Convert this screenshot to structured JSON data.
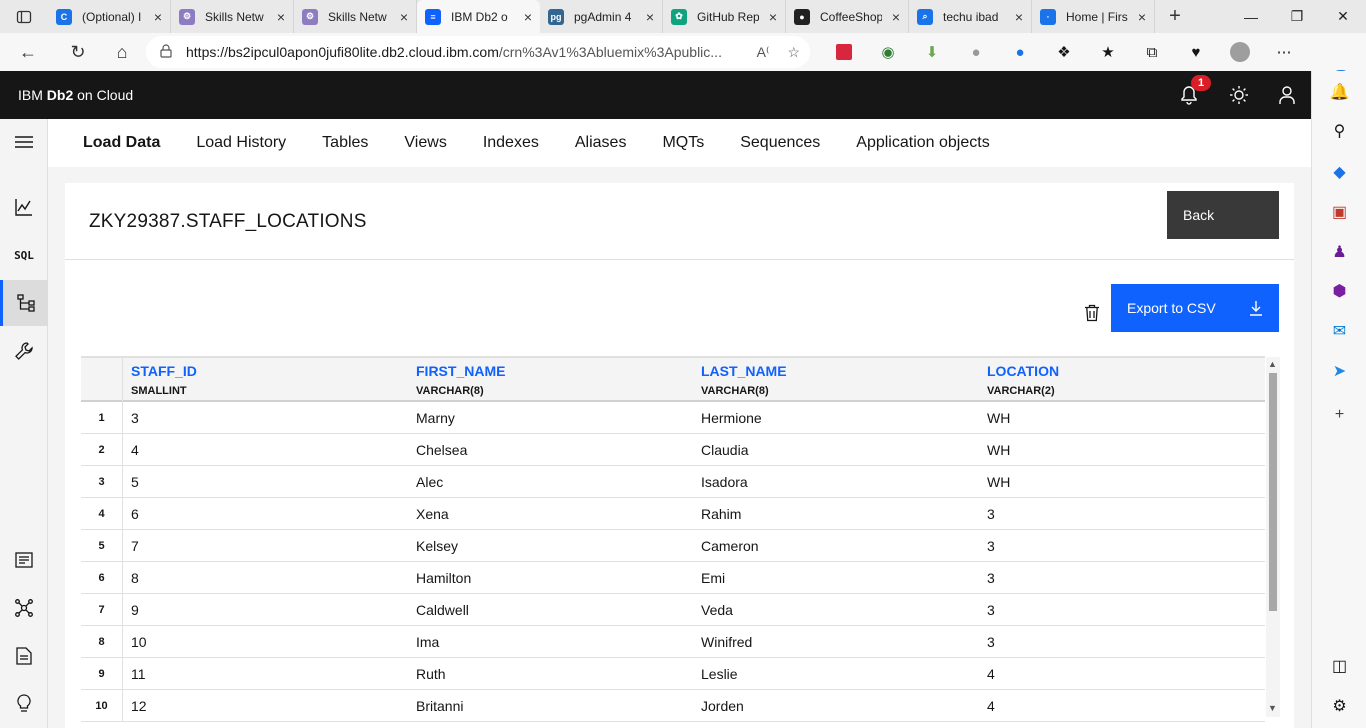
{
  "browser": {
    "tabs": [
      {
        "title": "(Optional) I",
        "icon": "C",
        "color": "#1a73e8"
      },
      {
        "title": "Skills Netw",
        "icon": "⚙",
        "color": "#8e7cc3"
      },
      {
        "title": "Skills Netw",
        "icon": "⚙",
        "color": "#8e7cc3"
      },
      {
        "title": "IBM Db2 o",
        "icon": "≡",
        "color": "#0f62fe",
        "active": true
      },
      {
        "title": "pgAdmin 4",
        "icon": "pg",
        "color": "#336791"
      },
      {
        "title": "GitHub Rep",
        "icon": "✿",
        "color": "#10a37f"
      },
      {
        "title": "CoffeeShop",
        "icon": "●",
        "color": "#222222"
      },
      {
        "title": "techu ibad",
        "icon": "⌕",
        "color": "#1a73e8"
      },
      {
        "title": "Home | Firs",
        "icon": "∙",
        "color": "#1a73e8"
      }
    ],
    "url_host": "https://bs2ipcul0apon0jufi80lite.db2.cloud.ibm.com",
    "url_path": "/crn%3Av1%3Abluemix%3Apublic..."
  },
  "app": {
    "brand_prefix": "IBM ",
    "brand_bold": "Db2",
    "brand_suffix": " on Cloud",
    "notification_count": "1"
  },
  "nav": {
    "tabs": [
      "Load Data",
      "Load History",
      "Tables",
      "Views",
      "Indexes",
      "Aliases",
      "MQTs",
      "Sequences",
      "Application objects"
    ]
  },
  "page": {
    "title": "ZKY29387.STAFF_LOCATIONS",
    "back_label": "Back",
    "export_label": "Export to CSV"
  },
  "table": {
    "columns": [
      {
        "name": "STAFF_ID",
        "type": "SMALLINT"
      },
      {
        "name": "FIRST_NAME",
        "type": "VARCHAR(8)"
      },
      {
        "name": "LAST_NAME",
        "type": "VARCHAR(8)"
      },
      {
        "name": "LOCATION",
        "type": "VARCHAR(2)"
      }
    ],
    "rows": [
      {
        "n": "1",
        "staff_id": "3",
        "first_name": "Marny",
        "last_name": "Hermione",
        "location": "WH"
      },
      {
        "n": "2",
        "staff_id": "4",
        "first_name": "Chelsea",
        "last_name": "Claudia",
        "location": "WH"
      },
      {
        "n": "3",
        "staff_id": "5",
        "first_name": "Alec",
        "last_name": "Isadora",
        "location": "WH"
      },
      {
        "n": "4",
        "staff_id": "6",
        "first_name": "Xena",
        "last_name": "Rahim",
        "location": "3"
      },
      {
        "n": "5",
        "staff_id": "7",
        "first_name": "Kelsey",
        "last_name": "Cameron",
        "location": "3"
      },
      {
        "n": "6",
        "staff_id": "8",
        "first_name": "Hamilton",
        "last_name": "Emi",
        "location": "3"
      },
      {
        "n": "7",
        "staff_id": "9",
        "first_name": "Caldwell",
        "last_name": "Veda",
        "location": "3"
      },
      {
        "n": "8",
        "staff_id": "10",
        "first_name": "Ima",
        "last_name": "Winifred",
        "location": "3"
      },
      {
        "n": "9",
        "staff_id": "11",
        "first_name": "Ruth",
        "last_name": "Leslie",
        "location": "4"
      },
      {
        "n": "10",
        "staff_id": "12",
        "first_name": "Britanni",
        "last_name": "Jorden",
        "location": "4"
      }
    ]
  }
}
